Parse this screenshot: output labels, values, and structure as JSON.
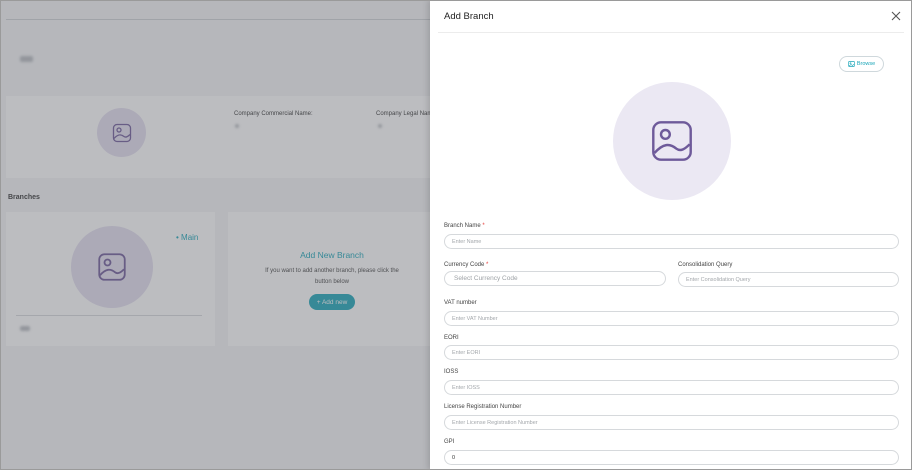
{
  "background": {
    "company": {
      "commercial_name_label": "Company Commercial Name:",
      "legal_name_label": "Company Legal Name"
    },
    "branches_title": "Branches",
    "main_branch": {
      "tag": "• Main"
    },
    "add_branch_card": {
      "title": "Add New Branch",
      "description": "If you want to add another branch, please click the button below",
      "button_label": "+ Add new"
    }
  },
  "drawer": {
    "title": "Add Branch",
    "browse_label": "Browse",
    "fields": {
      "branch_name": {
        "label": "Branch Name",
        "required": "*",
        "placeholder": "Enter Name"
      },
      "currency_code": {
        "label": "Currency Code",
        "required": "*",
        "placeholder": "Select Currency Code"
      },
      "consolidation_query": {
        "label": "Consolidation Query",
        "placeholder": "Enter Consolidation Query"
      },
      "vat_number": {
        "label": "VAT number",
        "placeholder": "Enter VAT Number"
      },
      "eori": {
        "label": "EORI",
        "placeholder": "Enter EORI"
      },
      "ioss": {
        "label": "IOSS",
        "placeholder": "Enter IOSS"
      },
      "license_registration_number": {
        "label": "License Registration Number",
        "placeholder": "Enter License Registration Number"
      },
      "gpi": {
        "label": "GPI",
        "value": "0"
      }
    }
  },
  "icons": {
    "close": "close-icon",
    "browse": "image-icon",
    "placeholder_image": "image-placeholder-icon"
  },
  "colors": {
    "accent": "#1aa5b8",
    "avatar_bg": "#ebe8f3",
    "icon_stroke": "#6e5a9a",
    "required": "#e53935"
  }
}
